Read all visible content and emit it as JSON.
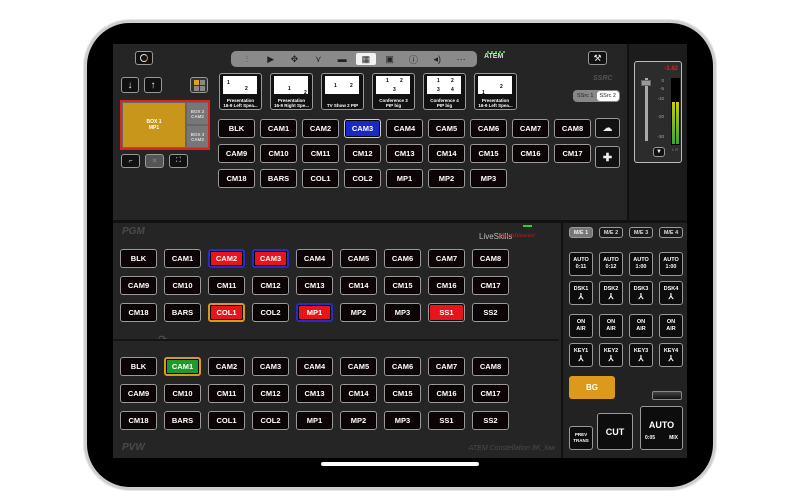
{
  "toolbar": {
    "items": [
      {
        "icon": "mixer-sliders-icon",
        "glyph": "⫶"
      },
      {
        "icon": "play-icon",
        "glyph": "▶"
      },
      {
        "icon": "move-icon",
        "glyph": "✥"
      },
      {
        "icon": "transition-fork-icon",
        "glyph": "⋎"
      },
      {
        "icon": "monitor-icon",
        "glyph": "▬"
      },
      {
        "icon": "multiview-icon",
        "glyph": "▦",
        "active": true
      },
      {
        "icon": "media-icon",
        "glyph": "▣"
      },
      {
        "icon": "info-icon",
        "glyph": "ⓘ"
      },
      {
        "icon": "audio-icon",
        "glyph": "◂)"
      },
      {
        "icon": "more-icon",
        "glyph": "⋯"
      }
    ],
    "logo": "ATEM"
  },
  "supersource": {
    "title": "SSRC",
    "toggle": [
      "SSrc 1",
      "SSrc 2"
    ],
    "active_toggle": "SSrc 2",
    "presets": [
      {
        "label_line1": "Presentation",
        "label_line2": "16-9 Left Spea...",
        "nums": [
          "1",
          "2"
        ]
      },
      {
        "label_line1": "Presentation",
        "label_line2": "16-9 Right Spe...",
        "nums": [
          "1",
          "2"
        ]
      },
      {
        "label_line1": "TV Show 2 PIP",
        "label_line2": "",
        "nums": [
          "1",
          "2"
        ]
      },
      {
        "label_line1": "Conference 3",
        "label_line2": "PIP big",
        "nums": [
          "1",
          "2",
          "3"
        ]
      },
      {
        "label_line1": "Conference 4",
        "label_line2": "PIP big",
        "nums": [
          "1",
          "2",
          "3",
          "4"
        ]
      },
      {
        "label_line1": "Presentation",
        "label_line2": "16-9 Left Spea...",
        "nums": [
          "1",
          "2"
        ]
      }
    ],
    "boxes": {
      "box1": "BOX 1\nMP1",
      "box2": "BOX 2\nCAM2",
      "box3": "BOX 3\nCAM3"
    },
    "sources": [
      [
        "BLK",
        "CAM1",
        "CAM2",
        "CAM3",
        "CAM4",
        "CAM5",
        "CAM6",
        "CAM7",
        "CAM8"
      ],
      [
        "CAM9",
        "CM10",
        "CM11",
        "CM12",
        "CM13",
        "CM14",
        "CM15",
        "CM16",
        "CM17"
      ],
      [
        "CM18",
        "BARS",
        "COL1",
        "COL2",
        "MP1",
        "MP2",
        "MP3"
      ]
    ],
    "selected": "CAM3"
  },
  "audio": {
    "level_db": "-3.82",
    "scale": [
      "0",
      "-5",
      "-10",
      "-20",
      "-30",
      "-50"
    ],
    "channels": "L R"
  },
  "pgm": {
    "label": "PGM",
    "brand": "LiveSkills",
    "brand_sub": "TouchDirector",
    "rows": [
      [
        {
          "t": "BLK"
        },
        {
          "t": "CAM1"
        },
        {
          "t": "CAM2",
          "s": "red-blue"
        },
        {
          "t": "CAM3",
          "s": "red-blue"
        },
        {
          "t": "CAM4"
        },
        {
          "t": "CAM5"
        },
        {
          "t": "CAM6"
        },
        {
          "t": "CAM7"
        },
        {
          "t": "CAM8"
        }
      ],
      [
        {
          "t": "CAM9"
        },
        {
          "t": "CM10"
        },
        {
          "t": "CM11"
        },
        {
          "t": "CM12"
        },
        {
          "t": "CM13"
        },
        {
          "t": "CM14"
        },
        {
          "t": "CM15"
        },
        {
          "t": "CM16"
        },
        {
          "t": "CM17"
        }
      ],
      [
        {
          "t": "CM18"
        },
        {
          "t": "BARS"
        },
        {
          "t": "COL1",
          "s": "red-orange"
        },
        {
          "t": "COL2"
        },
        {
          "t": "MP1",
          "s": "red-blue"
        },
        {
          "t": "MP2"
        },
        {
          "t": "MP3"
        },
        {
          "t": "SS1",
          "s": "red"
        },
        {
          "t": "SS2"
        }
      ]
    ]
  },
  "pvw": {
    "label": "PVW",
    "device_name": "ATEM Constellation 8K_low",
    "rows": [
      [
        {
          "t": "BLK"
        },
        {
          "t": "CAM1",
          "s": "green-orange"
        },
        {
          "t": "CAM2"
        },
        {
          "t": "CAM3"
        },
        {
          "t": "CAM4"
        },
        {
          "t": "CAM5"
        },
        {
          "t": "CAM6"
        },
        {
          "t": "CAM7"
        },
        {
          "t": "CAM8"
        }
      ],
      [
        {
          "t": "CAM9"
        },
        {
          "t": "CM10"
        },
        {
          "t": "CM11"
        },
        {
          "t": "CM12"
        },
        {
          "t": "CM13"
        },
        {
          "t": "CM14"
        },
        {
          "t": "CM15"
        },
        {
          "t": "CM16"
        },
        {
          "t": "CM17"
        }
      ],
      [
        {
          "t": "CM18"
        },
        {
          "t": "BARS"
        },
        {
          "t": "COL1"
        },
        {
          "t": "COL2"
        },
        {
          "t": "MP1"
        },
        {
          "t": "MP2"
        },
        {
          "t": "MP3"
        },
        {
          "t": "SS1"
        },
        {
          "t": "SS2"
        }
      ]
    ]
  },
  "control": {
    "me_tabs": [
      "M/E 1",
      "M/E 2",
      "M/E 3",
      "M/E 4"
    ],
    "active_me": "M/E 1",
    "auto": [
      {
        "label": "AUTO",
        "time": "0:11"
      },
      {
        "label": "AUTO",
        "time": "0:12"
      },
      {
        "label": "AUTO",
        "time": "1:00"
      },
      {
        "label": "AUTO",
        "time": "1:00"
      }
    ],
    "dsk": [
      "DSK1",
      "DSK2",
      "DSK3",
      "DSK4"
    ],
    "on_air": [
      "ON\nAIR",
      "ON\nAIR",
      "ON\nAIR",
      "ON\nAIR"
    ],
    "keys": [
      "KEY1",
      "KEY2",
      "KEY3",
      "KEY4"
    ],
    "bg": "BG",
    "prev_trans": [
      "PREV",
      "TRANS"
    ],
    "cut": "CUT",
    "auto_main": {
      "label": "AUTO",
      "time": "0:05",
      "type": "MIX"
    }
  },
  "colors": {
    "program_red": "#e8141a",
    "preview_green": "#1f9a2a",
    "selected_blue": "#1a28c8",
    "accent_orange": "#dd9a1a"
  }
}
